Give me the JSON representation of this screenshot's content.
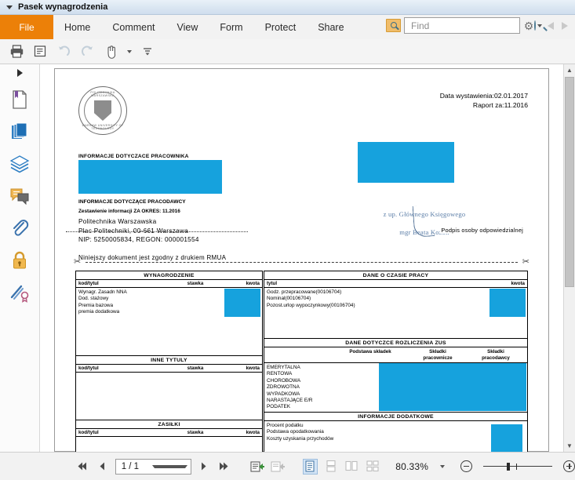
{
  "window": {
    "title": "Pasek wynagrodzenia",
    "caret_icon": "chevron-down-icon"
  },
  "ribbon": {
    "tabs": [
      {
        "label": "File",
        "id": "file"
      },
      {
        "label": "Home",
        "id": "home"
      },
      {
        "label": "Comment",
        "id": "comment"
      },
      {
        "label": "View",
        "id": "view"
      },
      {
        "label": "Form",
        "id": "form"
      },
      {
        "label": "Protect",
        "id": "protect"
      },
      {
        "label": "Share",
        "id": "share"
      }
    ],
    "search": {
      "placeholder": "Find",
      "value": "",
      "icon": "find-toolbox-icon",
      "magnifier_icon": "magnifier-icon"
    },
    "settings_icon": "gear-icon",
    "prev_icon": "chevron-left-icon",
    "next_icon": "chevron-right-icon",
    "quick_access": [
      {
        "name": "print-icon"
      },
      {
        "name": "properties-icon"
      },
      {
        "name": "undo-icon"
      },
      {
        "name": "redo-icon"
      },
      {
        "name": "hand-tool-icon"
      },
      {
        "name": "customize-toolbar-icon"
      }
    ]
  },
  "sidebar": {
    "expand_icon": "expand-panel-arrow-icon",
    "items": [
      {
        "name": "bookmarks-icon"
      },
      {
        "name": "page-thumbnails-icon"
      },
      {
        "name": "layers-icon"
      },
      {
        "name": "comments-icon"
      },
      {
        "name": "attachments-icon"
      },
      {
        "name": "security-lock-icon"
      },
      {
        "name": "digital-signature-icon"
      }
    ]
  },
  "document": {
    "logo": {
      "top_text": "POLITECHNIKA WARSZAWSKA",
      "bottom_text": "WARSAW UNIVERSITY OF TECHNOLOGY"
    },
    "dates": {
      "issue": "Data wystawienia:02.01.2017",
      "report": "Raport za:11.2016"
    },
    "employee_section_title": "INFORMACJE DOTYCZACE PRACOWNIKA",
    "employer": {
      "title": "INFORMACJE DOTYCZĄCE PRACODAWCY",
      "period": "Zestawienie informacji ZA OKRES: 11.2016",
      "name": "Politechnika Warszawska",
      "address": "Plac Politechniki, 00-661 Warszawa",
      "ids": "NIP: 5250005834,   REGON: 000001554"
    },
    "rmua_note": "Niniejszy dokument jest zgodny z drukiem RMUA",
    "signature": {
      "line1": "z up. Głównego Księgowego",
      "line2": "mgr Beata Kozoń",
      "caption": "Podpis osoby odpowiedzialnej"
    },
    "cut_icon": "scissors-icon",
    "tables": {
      "wynagrodzenie": {
        "banner": "WYNAGRODZENIE",
        "headers": [
          "kod/tytul",
          "stawka",
          "kwota"
        ],
        "rows": [
          "Wynagr. Zasadn NNA",
          "Dod. stażowy",
          "Premia bazowa",
          "premia dodatkowa"
        ]
      },
      "inne_tytuly": {
        "banner": "INNE TYTULY",
        "headers": [
          "kod/tytul",
          "stawka",
          "kwota"
        ],
        "rows": []
      },
      "zasilki": {
        "banner": "ZASIŁKI",
        "headers": [
          "kod/tytul",
          "stawka",
          "kwota"
        ],
        "rows": []
      },
      "czas_pracy": {
        "banner": "DANE O CZASIE PRACY",
        "headers": [
          "tytul",
          "kwota"
        ],
        "rows": [
          "Godz. przepracowane(00106704)",
          "Nominal(00106704)",
          "Pozost.urlop wypoczynkowy(00106704)"
        ]
      },
      "zus": {
        "banner": "DANE DOTYCZCE ROZLICZENIA ZUS",
        "headers": [
          "",
          "Podstawa składek",
          "Składki pracownicze",
          "Składki pracodawcy"
        ],
        "header_c3_l1": "Składki",
        "header_c3_l2": "pracownicze",
        "header_c4_l1": "Składki",
        "header_c4_l2": "pracodawcy",
        "rows": [
          "EMERYTALNA",
          "RENTOWA",
          "CHOROBOWA",
          "ZDROWOTNA",
          "WYPADKOWA",
          "NARASTAJĄCE E/R",
          "PODATEK"
        ]
      },
      "info_dodatkowe": {
        "banner": "INFORMACJE DODATKOWE",
        "rows": [
          "Procent podatku",
          "Podstawa opodatkowania",
          "Koszty uzyskania przychodów"
        ]
      }
    }
  },
  "bottom_bar": {
    "first_page_icon": "first-page-icon",
    "prev_page_icon": "previous-page-icon",
    "page_value": "1 / 1",
    "page_dropdown_icon": "chevron-down-icon",
    "next_page_icon": "next-page-icon",
    "last_page_icon": "last-page-icon",
    "fit_page_icon": "fit-page-icon",
    "fit_width_icon": "fit-width-icon",
    "view_single_icon": "single-page-view-icon",
    "view_continuous_icon": "continuous-view-icon",
    "view_facing_icon": "facing-pages-view-icon",
    "view_facing_cont_icon": "facing-continuous-view-icon",
    "zoom_value": "80.33%",
    "zoom_dropdown_icon": "chevron-down-icon",
    "zoom_out_icon": "zoom-out-icon",
    "zoom_in_icon": "zoom-in-icon"
  },
  "colors": {
    "redaction": "#16a2dd",
    "file_tab": "#ec8008",
    "active_view": "#d3e4f5"
  }
}
